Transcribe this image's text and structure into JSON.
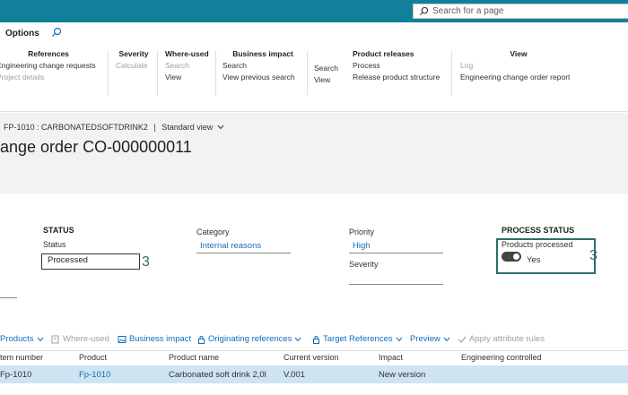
{
  "topbar": {
    "search_placeholder": "Search for a page"
  },
  "actionpane": {
    "tab": "Options",
    "groups": {
      "references": {
        "title": "References",
        "items": [
          "Engineering change requests",
          "Project details"
        ]
      },
      "severity": {
        "title": "Severity",
        "items": [
          "Calculate"
        ]
      },
      "where_used": {
        "title": "Where-used",
        "items": [
          "Search",
          "View"
        ]
      },
      "business_impact": {
        "title": "Business impact",
        "items": [
          "Search",
          "View previous search"
        ]
      },
      "product_releases_a": {
        "items": [
          "Search",
          "View"
        ]
      },
      "product_releases": {
        "title": "Product releases",
        "items": [
          "Process",
          "Release product structure"
        ]
      },
      "view": {
        "title": "View",
        "items": [
          "Log",
          "Engineering change order report"
        ]
      }
    }
  },
  "header": {
    "breadcrumb_product": "FP-1010 : CARBONATEDSOFTDRINK2",
    "breadcrumb_sep": "|",
    "view_name": "Standard view",
    "title": "ange order CO-000000011"
  },
  "fields": {
    "status_section": "STATUS",
    "status_label": "Status",
    "status_value": "Processed",
    "category_label": "Category",
    "category_value": "Internal reasons",
    "priority_label": "Priority",
    "priority_value": "High",
    "severity_label": "Severity",
    "process_status_section": "PROCESS STATUS",
    "products_processed_label": "Products processed",
    "products_processed_value": "Yes",
    "callout_left": "3",
    "callout_right": "3"
  },
  "linetoolbar": {
    "products": "Products",
    "where_used": "Where-used",
    "business_impact": "Business impact",
    "originating_references": "Originating references",
    "target_references": "Target References",
    "preview": "Preview",
    "apply_attribute_rules": "Apply attribute rules"
  },
  "grid": {
    "columns": [
      "tem number",
      "Product",
      "Product name",
      "Current version",
      "Impact",
      "Engineering controlled"
    ],
    "rows": [
      {
        "item_number": "Fp-1010",
        "product": "Fp-1010",
        "product_name": "Carbonated soft drink 2,0l",
        "current_version": "V.001",
        "impact": "New version",
        "engineering_controlled": ""
      }
    ]
  },
  "colors": {
    "topbar": "#11809a",
    "link": "#106ebe",
    "callout": "#2d6e6c",
    "selected_row": "#cfe4f2"
  }
}
